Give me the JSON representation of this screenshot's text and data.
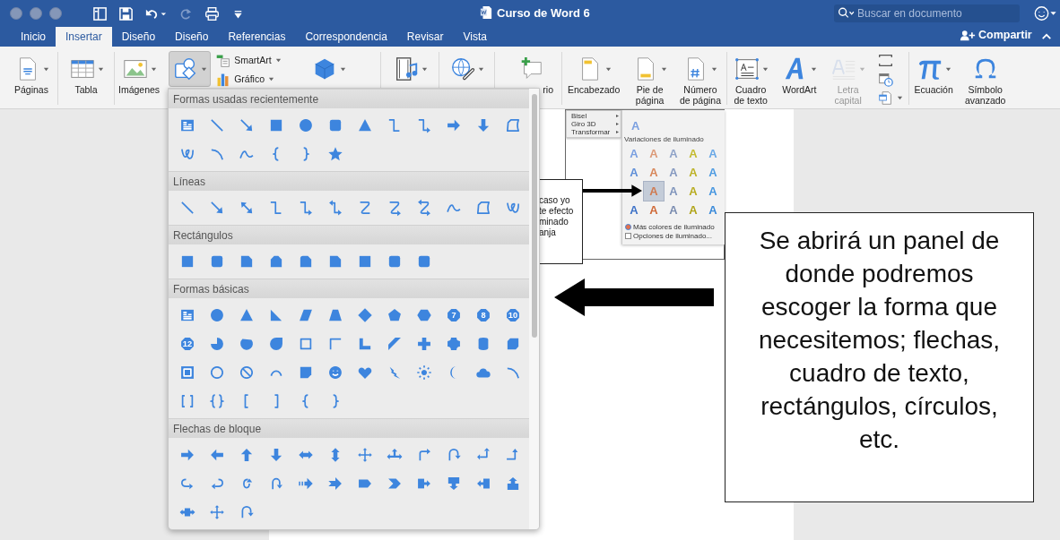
{
  "window": {
    "title": "Curso de Word 6",
    "search": {
      "placeholder": "Buscar en documento"
    }
  },
  "tabs": [
    {
      "label": "Inicio",
      "selected": false
    },
    {
      "label": "Insertar",
      "selected": true
    },
    {
      "label": "Diseño",
      "selected": false
    },
    {
      "label": "Diseño",
      "selected": false
    },
    {
      "label": "Referencias",
      "selected": false
    },
    {
      "label": "Correspondencia",
      "selected": false
    },
    {
      "label": "Revisar",
      "selected": false
    },
    {
      "label": "Vista",
      "selected": false
    }
  ],
  "share": {
    "label": "Compartir"
  },
  "ribbon": {
    "groups": [
      [
        {
          "kind": "large",
          "lines": [
            "Páginas"
          ],
          "dropdown": true,
          "selected": false,
          "disabled": false
        }
      ],
      [
        {
          "kind": "large",
          "lines": [
            "Tabla"
          ],
          "dropdown": true,
          "selected": false,
          "disabled": false
        }
      ],
      [
        {
          "kind": "large",
          "lines": [
            "Imágenes"
          ],
          "dropdown": true,
          "selected": false,
          "disabled": false
        },
        {
          "kind": "large",
          "dropdown": true,
          "selected": true,
          "disabled": false
        },
        {
          "kind": "stack",
          "items": [
            {
              "label": "SmartArt",
              "dropdown": true
            },
            {
              "label": "Gráfico",
              "dropdown": true
            }
          ]
        },
        {
          "kind": "large",
          "dropdown": true,
          "selected": false,
          "disabled": false
        }
      ],
      [
        {
          "kind": "large",
          "dropdown": true,
          "selected": false,
          "disabled": false
        }
      ],
      [
        {
          "kind": "large",
          "dropdown": true,
          "selected": false,
          "disabled": false
        }
      ],
      [
        {
          "kind": "large",
          "lines": [
            "rio"
          ],
          "dropdown": false,
          "selected": false,
          "disabled": false
        }
      ],
      [
        {
          "kind": "large",
          "lines": [
            "Encabezado"
          ],
          "dropdown": true,
          "selected": false,
          "disabled": false
        },
        {
          "kind": "large",
          "lines": [
            "Pie de",
            "página"
          ],
          "dropdown": true,
          "selected": false,
          "disabled": false
        },
        {
          "kind": "large",
          "lines": [
            "Número",
            "de página"
          ],
          "dropdown": true,
          "selected": false,
          "disabled": false
        }
      ],
      [
        {
          "kind": "large",
          "lines": [
            "Cuadro",
            "de texto"
          ],
          "dropdown": true,
          "selected": false,
          "disabled": false
        },
        {
          "kind": "large",
          "lines": [
            "WordArt"
          ],
          "dropdown": true,
          "selected": false,
          "disabled": false
        },
        {
          "kind": "large",
          "lines": [
            "Letra",
            "capital"
          ],
          "dropdown": true,
          "selected": false,
          "disabled": true
        },
        {
          "kind": "stack",
          "items": [
            {
              "dropdown": false
            },
            {
              "dropdown": false
            },
            {
              "dropdown": true
            }
          ]
        }
      ],
      [
        {
          "kind": "large",
          "lines": [
            "Ecuación"
          ],
          "dropdown": true,
          "selected": false,
          "disabled": false
        },
        {
          "kind": "large",
          "lines": [
            "Símbolo",
            "avanzado"
          ],
          "dropdown": false,
          "selected": false,
          "disabled": false
        }
      ]
    ]
  },
  "shapes_panel": {
    "sections": [
      {
        "title": "Formas usadas recientemente"
      },
      {
        "title": "Líneas"
      },
      {
        "title": "Rectángulos"
      },
      {
        "title": "Formas básicas",
        "badges": [
          "7",
          "8",
          "10",
          "12"
        ]
      },
      {
        "title": "Flechas de bloque"
      }
    ]
  },
  "document": {
    "embedded_screenshot": {
      "menu": [
        "Bisel",
        "Giro 3D",
        "Transformar"
      ],
      "top_variant": "A",
      "section": "Variaciones de iluminado",
      "variants": [
        {
          "letter": "A",
          "color": "#7a9fe0",
          "selected": false
        },
        {
          "letter": "A",
          "color": "#dc9a78",
          "selected": false
        },
        {
          "letter": "A",
          "color": "#8fa3c8",
          "selected": false
        },
        {
          "letter": "A",
          "color": "#c4bb30",
          "selected": false
        },
        {
          "letter": "A",
          "color": "#6aa8e6",
          "selected": false
        },
        {
          "letter": "A",
          "color": "#5f8fd8",
          "selected": false
        },
        {
          "letter": "A",
          "color": "#d8875a",
          "selected": false
        },
        {
          "letter": "A",
          "color": "#8599c0",
          "selected": false
        },
        {
          "letter": "A",
          "color": "#bdb228",
          "selected": false
        },
        {
          "letter": "A",
          "color": "#4f9ce2",
          "selected": false
        },
        {
          "letter": "A",
          "color": "#d07a50",
          "selected": true
        },
        {
          "letter": "A",
          "color": "#8095bc",
          "selected": false
        },
        {
          "letter": "A",
          "color": "#b8ac20",
          "selected": false
        },
        {
          "letter": "A",
          "color": "#4696e0",
          "selected": false
        },
        {
          "letter": "A",
          "color": "#3d72c8",
          "selected": false
        },
        {
          "letter": "A",
          "color": "#d06a38",
          "selected": false
        },
        {
          "letter": "A",
          "color": "#7a8cb0",
          "selected": false
        },
        {
          "letter": "A",
          "color": "#b0a418",
          "selected": false
        },
        {
          "letter": "A",
          "color": "#3a8ada",
          "selected": false
        }
      ],
      "links": [
        "Más colores de iluminado",
        "Opciones de iluminado..."
      ]
    },
    "text_box": {
      "lines": [
        "caso yo",
        "te efecto",
        "minado",
        "anja"
      ]
    },
    "callout": {
      "text": "Se abrirá un panel de donde podremos escoger la forma que necesitemos; flechas, cuadro de texto, rectángulos, círculos, etc."
    }
  }
}
